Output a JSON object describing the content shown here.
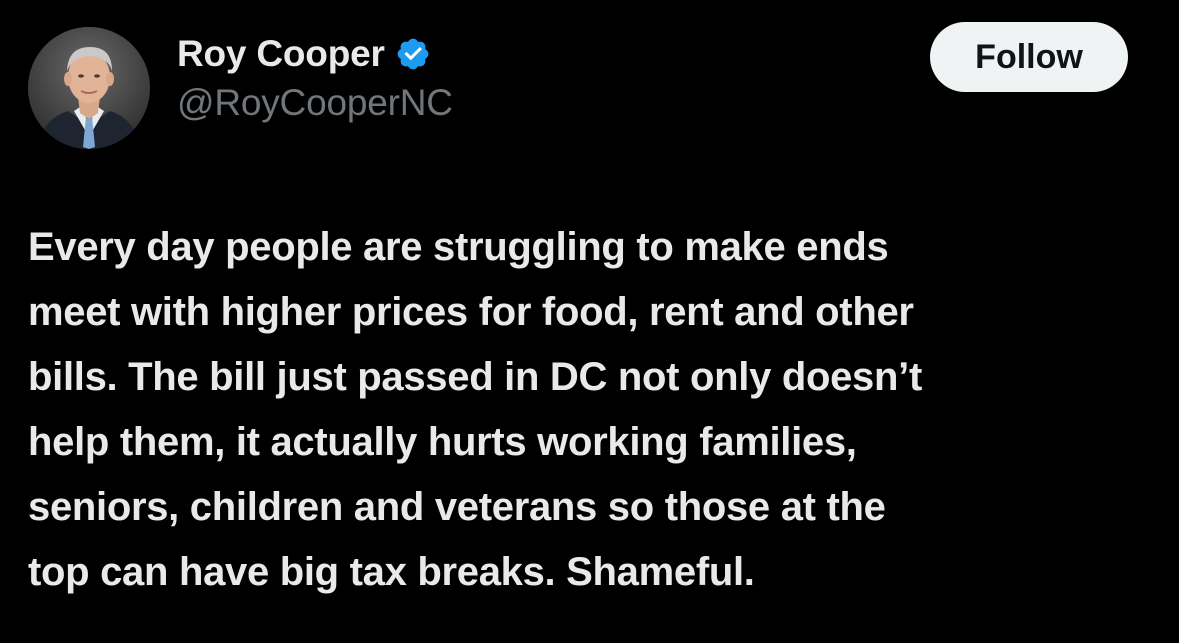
{
  "author": {
    "display_name": "Roy Cooper",
    "handle": "@RoyCooperNC",
    "verified": true,
    "avatar_icon": "profile-photo"
  },
  "follow_button": {
    "label": "Follow"
  },
  "tweet": {
    "lines": [
      "Every day people are struggling to make ends",
      "meet with higher prices for food, rent and other",
      "bills. The bill just passed in DC not only doesn’t",
      "help them, it actually hurts working families,",
      "seniors, children and veterans so those at the",
      "top can have big tax breaks. Shameful."
    ]
  },
  "colors": {
    "background": "#000000",
    "text": "#e7e9ea",
    "secondary_text": "#71767b",
    "verified_badge": "#1d9bf0",
    "follow_button_bg": "#eff3f4",
    "follow_button_text": "#0f1419"
  }
}
